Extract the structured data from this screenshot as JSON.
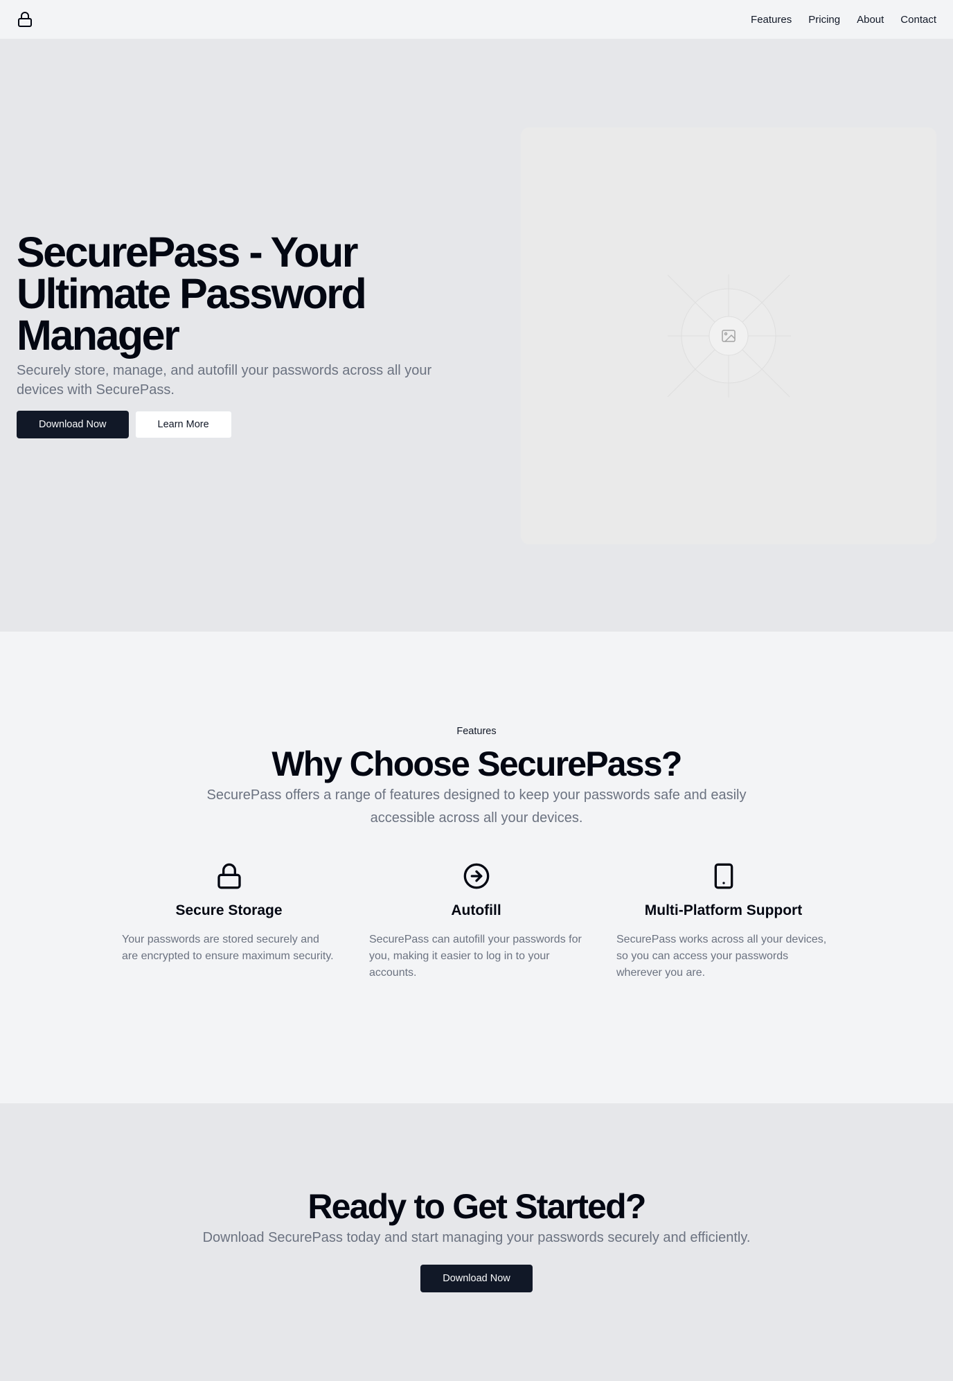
{
  "header": {
    "logo_icon": "lock-icon",
    "nav": [
      {
        "label": "Features"
      },
      {
        "label": "Pricing"
      },
      {
        "label": "About"
      },
      {
        "label": "Contact"
      }
    ]
  },
  "hero": {
    "title": "SecurePass - Your Ultimate Password Manager",
    "subtitle": "Securely store, manage, and autofill your passwords across all your devices with SecurePass.",
    "primary_button": "Download Now",
    "secondary_button": "Learn More",
    "image_icon": "image-placeholder-icon"
  },
  "features": {
    "eyebrow": "Features",
    "title": "Why Choose SecurePass?",
    "subtitle": "SecurePass offers a range of features designed to keep your passwords safe and easily accessible across all your devices.",
    "items": [
      {
        "icon": "lock-icon",
        "title": "Secure Storage",
        "description": "Your passwords are stored securely and are encrypted to ensure maximum security."
      },
      {
        "icon": "arrow-right-circle-icon",
        "title": "Autofill",
        "description": "SecurePass can autofill your passwords for you, making it easier to log in to your accounts."
      },
      {
        "icon": "tablet-icon",
        "title": "Multi-Platform Support",
        "description": "SecurePass works across all your devices, so you can access your passwords wherever you are."
      }
    ]
  },
  "cta": {
    "title": "Ready to Get Started?",
    "subtitle": "Download SecurePass today and start managing your passwords securely and efficiently.",
    "button": "Download Now"
  },
  "colors": {
    "primary_dark": "#111827",
    "muted_text": "#6b7280",
    "hero_bg": "#e6e7ea",
    "section_bg": "#f3f4f6"
  }
}
